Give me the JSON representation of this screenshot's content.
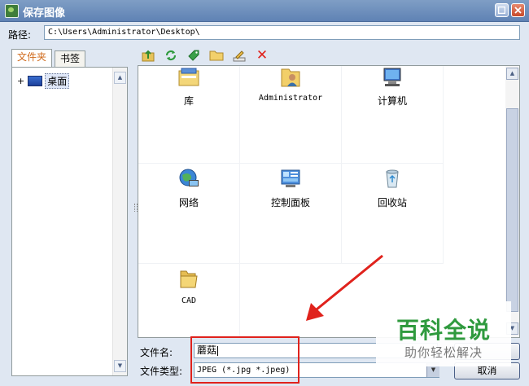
{
  "window": {
    "title": "保存图像",
    "buttons": [
      "maximize-icon",
      "close-icon"
    ]
  },
  "path": {
    "label": "路径:",
    "value": "C:\\Users\\Administrator\\Desktop\\"
  },
  "tabs": [
    {
      "label": "文件夹",
      "active": true
    },
    {
      "label": "书签",
      "active": false
    }
  ],
  "tree": {
    "expander": "+",
    "root_label": "桌面"
  },
  "toolbar": {
    "tools": [
      "up-folder-icon",
      "refresh-icon",
      "bookmark-tag-icon",
      "folder-icon",
      "rename-icon",
      "delete-icon"
    ],
    "delete_glyph": "✕"
  },
  "files": [
    {
      "label": "库",
      "icon": "library-icon"
    },
    {
      "label": "Administrator",
      "icon": "user-folder-icon"
    },
    {
      "label": "计算机",
      "icon": "computer-icon"
    },
    {
      "label": "网络",
      "icon": "network-icon"
    },
    {
      "label": "控制面板",
      "icon": "control-panel-icon"
    },
    {
      "label": "回收站",
      "icon": "recycle-bin-icon"
    },
    {
      "label": "CAD",
      "icon": "folder-icon"
    }
  ],
  "form": {
    "filename_label": "文件名:",
    "filename_value": "蘑菇",
    "filetype_label": "文件类型:",
    "filetype_value": "JPEG (*.jpg *.jpeg)"
  },
  "buttons": {
    "cancel": "取消"
  },
  "watermark": {
    "main": "百科全说",
    "sub": "助你轻松解决"
  },
  "colors": {
    "highlight": "#e0221c",
    "watermark_green": "#2f9a3e",
    "titlebar": "#6b8ec0"
  }
}
